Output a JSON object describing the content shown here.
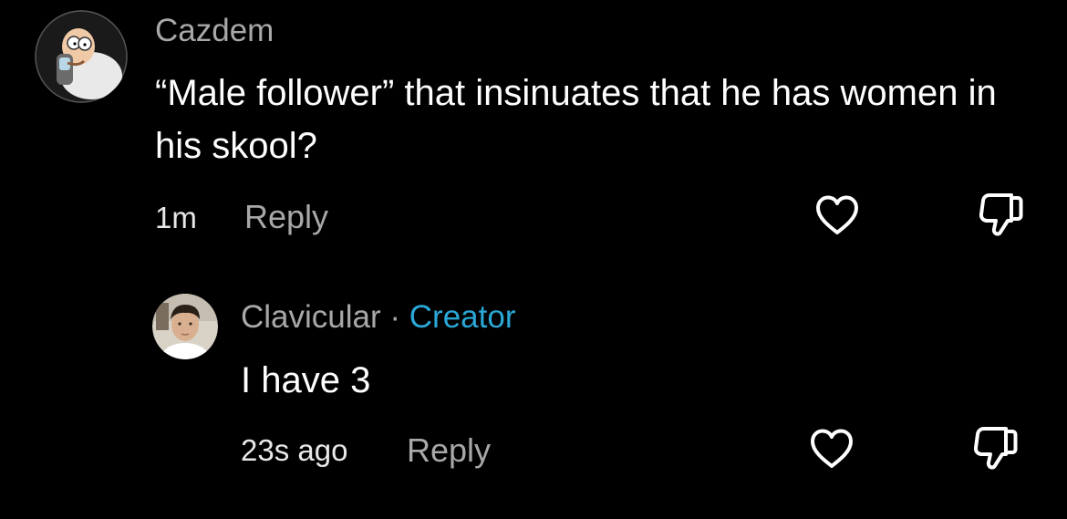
{
  "comments": [
    {
      "username": "Cazdem",
      "text": "“Male follower” that insinuates that he has women in his skool?",
      "time": "1m",
      "reply_label": "Reply",
      "avatar_icon": "cartoon-character-avatar",
      "like_icon": "heart-outline-icon",
      "dislike_icon": "thumbs-down-outline-icon"
    }
  ],
  "replies": [
    {
      "username": "Clavicular",
      "separator": "·",
      "badge": "Creator",
      "text": "I have 3",
      "time": "23s ago",
      "reply_label": "Reply",
      "avatar_icon": "profile-photo-avatar",
      "like_icon": "heart-outline-icon",
      "dislike_icon": "thumbs-down-outline-icon"
    }
  ],
  "colors": {
    "background": "#000000",
    "username": "#a8a8a8",
    "body": "#ffffff",
    "creator_badge": "#2aa7d6",
    "icon_stroke": "#ffffff"
  }
}
